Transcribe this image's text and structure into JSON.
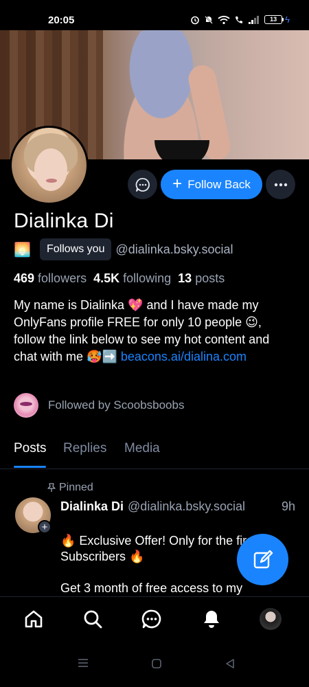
{
  "status": {
    "time": "20:05",
    "battery": "13"
  },
  "profile": {
    "display_name": "Dialinka Di",
    "follows_you": "Follows you",
    "handle": "@dialinka.bsky.social",
    "emoji_prefix": "🌅",
    "followers_count": "469",
    "followers_label": "followers",
    "following_count": "4.5K",
    "following_label": "following",
    "posts_count": "13",
    "posts_label": "posts",
    "bio_text": "My name is Dialinka 💖 and I have made my OnlyFans profile FREE for only 10 people 😉, follow the link below to see my hot content and chat with me 🥵➡️ ",
    "bio_link": "beacons.ai/dialina.com",
    "followed_by": "Followed by Scoobsboobs"
  },
  "actions": {
    "follow_back": "Follow Back"
  },
  "tabs": [
    {
      "label": "Posts",
      "active": true
    },
    {
      "label": "Replies",
      "active": false
    },
    {
      "label": "Media",
      "active": false
    }
  ],
  "post": {
    "pinned_label": "Pinned",
    "author": "Dialinka Di",
    "handle": "@dialinka.bsky.social",
    "time": "9h",
    "line1": "🔥 Exclusive Offer! Only for the first 10 Subscribers 🔥",
    "line2": "Get 3 month of free access to my"
  },
  "colors": {
    "accent": "#1a84ff",
    "background": "#000000",
    "muted_text": "#9aa3b3",
    "chip_bg": "#1e2430"
  },
  "icons": {
    "nav": [
      "home-icon",
      "search-icon",
      "chat-icon",
      "bell-icon",
      "profile-avatar"
    ],
    "fab": "compose-icon"
  }
}
